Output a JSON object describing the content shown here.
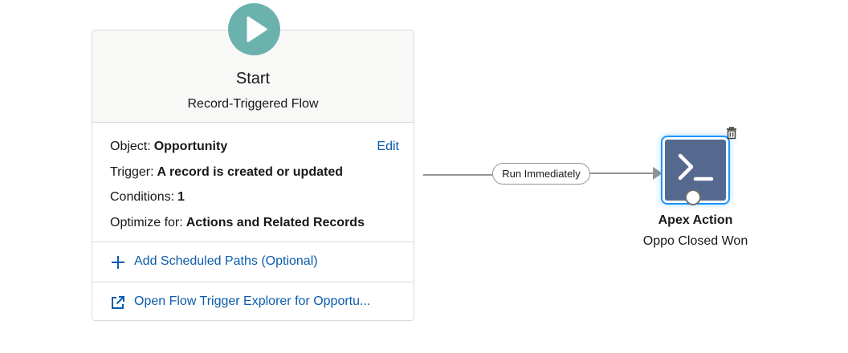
{
  "start": {
    "title": "Start",
    "subtitle": "Record-Triggered Flow",
    "icon": "play-icon",
    "icon_color": "#6bb2ae"
  },
  "details": {
    "object_label": "Object:",
    "object_value": "Opportunity",
    "edit_label": "Edit",
    "trigger_label": "Trigger:",
    "trigger_value": "A record is created or updated",
    "conditions_label": "Conditions:",
    "conditions_value": "1",
    "optimize_label": "Optimize for:",
    "optimize_value": "Actions and Related Records"
  },
  "actions": {
    "add_paths_label": "Add Scheduled Paths (Optional)",
    "add_paths_icon": "plus-icon",
    "explorer_label": "Open Flow Trigger Explorer for Opportu...",
    "explorer_icon": "external-link-icon"
  },
  "connector": {
    "label": "Run Immediately"
  },
  "apex": {
    "title": "Apex Action",
    "subtitle": "Oppo Closed Won",
    "icon": "terminal-prompt-icon",
    "node_color": "#54698d",
    "selection_color": "#1b96ff",
    "delete_icon": "trash-icon"
  },
  "colors": {
    "link": "#0b5cab",
    "border": "#dddbda",
    "header_bg": "#f8f8f7"
  }
}
